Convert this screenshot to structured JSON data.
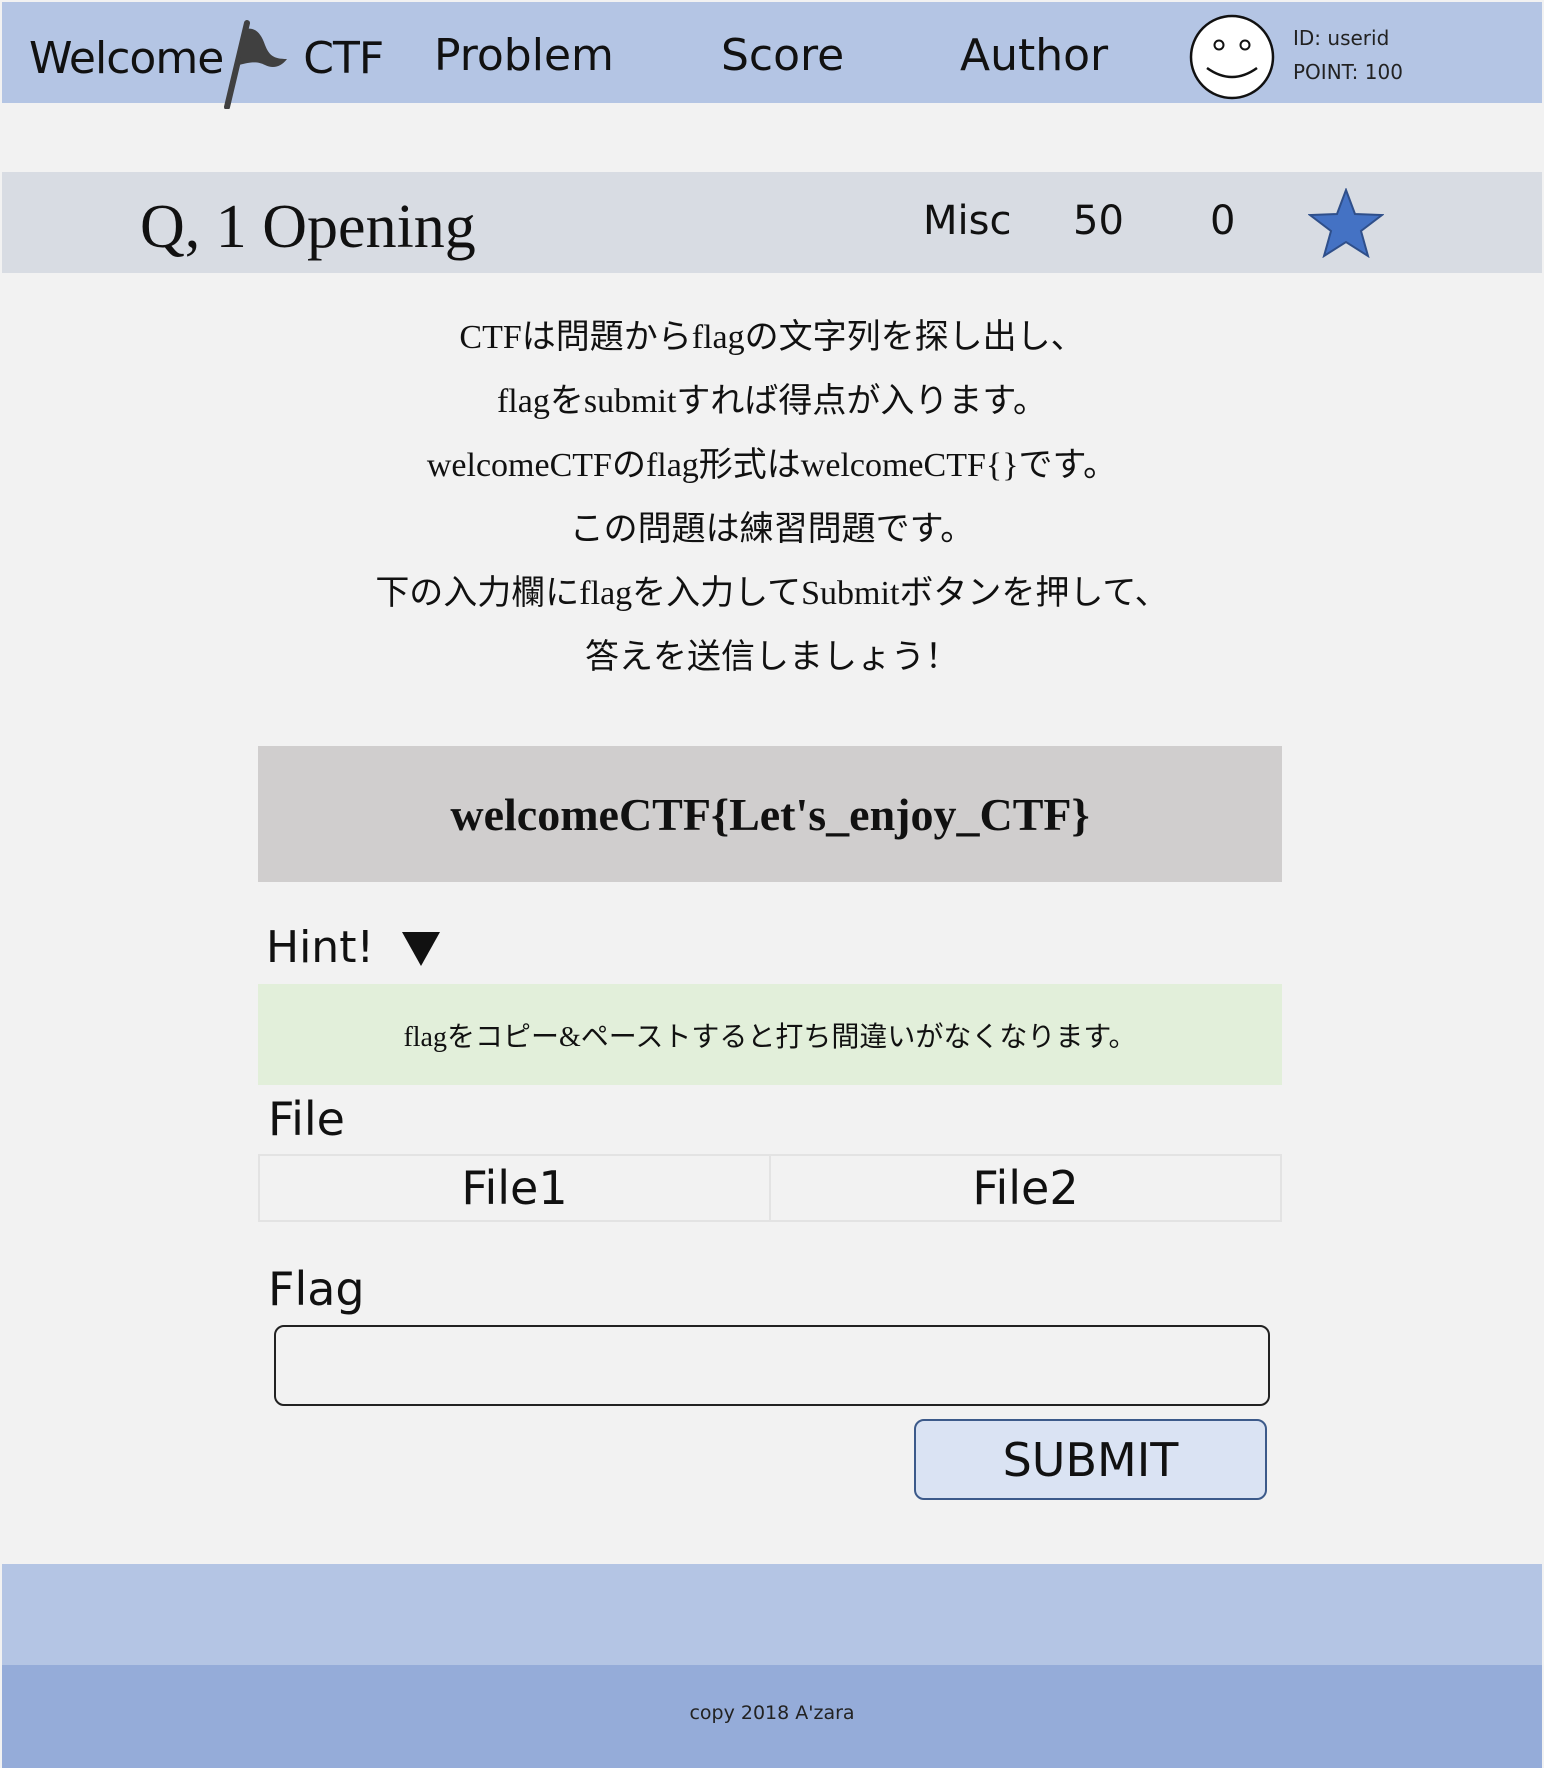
{
  "header": {
    "brand_left": "Welcome",
    "brand_right": "CTF",
    "nav": {
      "problem": "Problem",
      "score": "Score",
      "author": "Author"
    },
    "user": {
      "id_text": "ID: userid",
      "point_text": "POINT: 100"
    }
  },
  "question": {
    "title": "Q, 1 Opening",
    "category": "Misc",
    "points": "50",
    "solves": "0",
    "star_color": "#4472c4"
  },
  "description": {
    "lines": [
      "CTFは問題からflagの文字列を探し出し、",
      "flagをsubmitすれば得点が入ります。",
      "welcomeCTFのflag形式はwelcomeCTF{}です。",
      "この問題は練習問題です。",
      "下の入力欄にflagを入力してSubmitボタンを押して、",
      "答えを送信しましょう！"
    ]
  },
  "flag_sample": "welcomeCTF{Let's_enjoy_CTF}",
  "hint": {
    "label": "Hint!",
    "text": "flagをコピー&ペーストすると打ち間違いがなくなります。"
  },
  "files": {
    "label": "File",
    "items": [
      "File1",
      "File2"
    ]
  },
  "flag_form": {
    "label": "Flag",
    "value": "",
    "submit_label": "SUBMIT"
  },
  "footer": {
    "copyright": "copy 2018 A'zara"
  }
}
